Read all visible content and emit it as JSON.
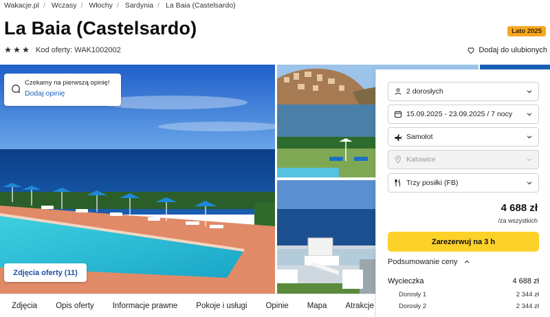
{
  "breadcrumbs": [
    "Wakacje.pl",
    "Wczasy",
    "Włochy",
    "Sardynia",
    "La Baia (Castelsardo)"
  ],
  "hotel": {
    "title": "La Baia (Castelsardo)",
    "badge": "Lato 2025",
    "stars": 3,
    "code_label": "Kod oferty: WAK1002002",
    "favorite_label": "Dodaj do ulubionych"
  },
  "review": {
    "prompt": "Czekamy na pierwszą opinię!",
    "link": "Dodaj opinię"
  },
  "gallery": {
    "photos_button": "Zdjęcia oferty (11)"
  },
  "tabs": [
    "Zdjęcia",
    "Opis oferty",
    "Informacje prawne",
    "Pokoje i usługi",
    "Opinie",
    "Mapa",
    "Atrakcje w okolicy"
  ],
  "booking": {
    "guests": "2 dorosłych",
    "dates": "15.09.2025 - 23.09.2025 / 7 nocy",
    "transport": "Samolot",
    "departure": "Katowice",
    "board": "Trzy posiłki (FB)",
    "price": "4 688 zł",
    "price_note": "/za wszystkich",
    "book_button": "Zarezerwuj na 3 h",
    "summary_label": "Podsumowanie ceny",
    "summary": {
      "trip_label": "Wycieczka",
      "trip_value": "4 688 zł",
      "rows": [
        {
          "label": "Dorosły 1",
          "value": "2 344 zł"
        },
        {
          "label": "Dorosły 2",
          "value": "2 344 zł"
        }
      ]
    }
  },
  "colors": {
    "accent_blue": "#1a5fb4",
    "badge": "#f7a823",
    "book_button": "#fcd12a"
  }
}
